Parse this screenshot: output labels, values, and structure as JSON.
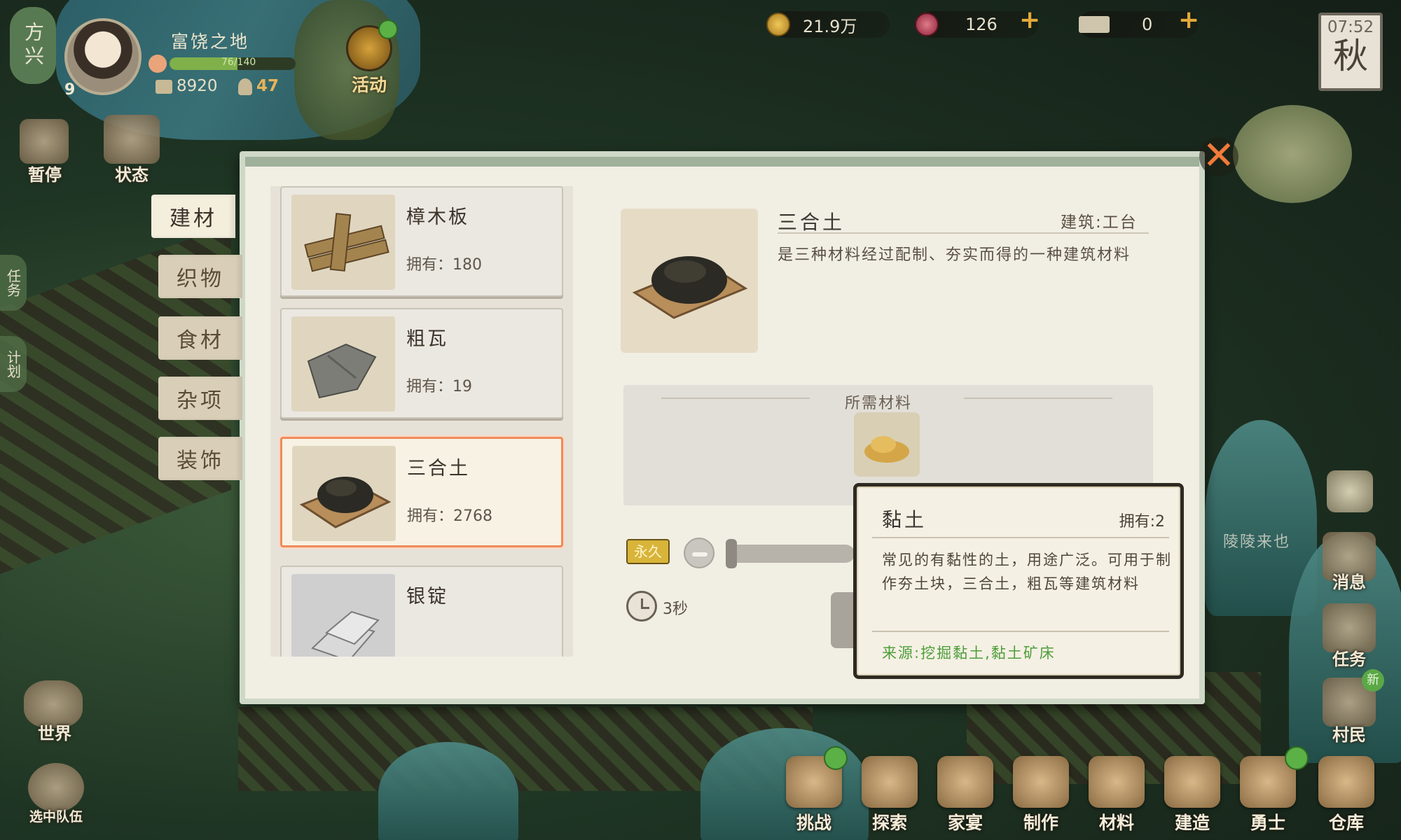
{
  "player": {
    "avatar_char": "方兴",
    "area_name": "富饶之地",
    "level": "9",
    "exp": "76/140",
    "storage": "8920",
    "population": "47"
  },
  "hud": {
    "activity_label": "活动",
    "coins": "21.9万",
    "gems": "126",
    "tickets": "0",
    "time": "07:52",
    "season": "秋"
  },
  "left_menu": {
    "pause": "暂停",
    "status": "状态",
    "task_side": "任务",
    "plan_side": "计划",
    "world": "世界",
    "team": "选中队伍"
  },
  "right_menu": {
    "news": "消息",
    "tasks": "任务",
    "villagers": "村民",
    "new_badge": "新",
    "event_text": "陵陵来也"
  },
  "bottom_bar": [
    "挑战",
    "探索",
    "家宴",
    "制作",
    "材料",
    "建造",
    "勇士",
    "仓库"
  ],
  "tabs": [
    "建材",
    "织物",
    "食材",
    "杂项",
    "装饰"
  ],
  "items": [
    {
      "name": "樟木板",
      "own": "拥有：180"
    },
    {
      "name": "粗瓦",
      "own": "拥有：19"
    },
    {
      "name": "三合土",
      "own": "拥有：2768"
    },
    {
      "name": "银锭",
      "own": ""
    }
  ],
  "detail": {
    "name": "三合土",
    "building": "建筑:工台",
    "description": "是三种材料经过配制、夯实而得的一种建筑材料",
    "materials_title": "所需材料",
    "permanent_badge": "永久",
    "duration": "3秒"
  },
  "tooltip": {
    "title": "黏土",
    "own": "拥有:2",
    "description": "常见的有黏性的土，用途广泛。可用于制作夯土块，三合土，粗瓦等建筑材料",
    "source": "来源:挖掘黏土,黏土矿床"
  }
}
